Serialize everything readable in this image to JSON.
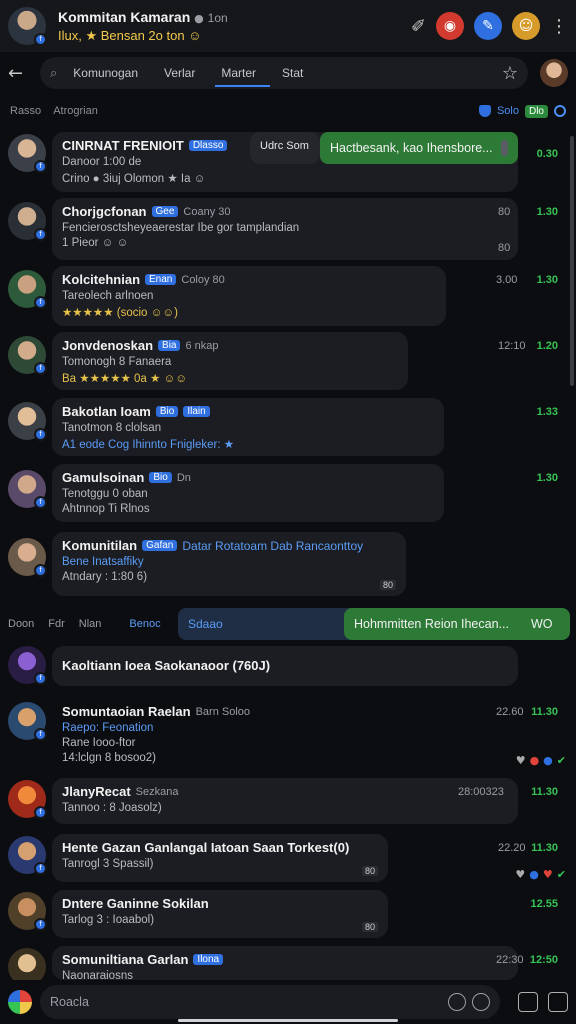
{
  "header": {
    "title": "Kommitan Kamaran",
    "title_suffix": "1on",
    "subtitle": "Ilux, ★ Bensan 2o ton ☺"
  },
  "tabs": {
    "items": [
      "Komunogan",
      "Verlar",
      "Marter",
      "Stat"
    ],
    "active": "Marter"
  },
  "section": {
    "left": "Rasso",
    "left2": "Atrogrian",
    "right_blue": "Solo",
    "right_green": "Dlo"
  },
  "chats": [
    {
      "name": "CINRNAT FRENIOIT",
      "tag": "Dlasso",
      "line1": "Danoor 1:00 de",
      "line2": "Crino ● 3iuj Olomon ★ Ia ☺",
      "pill_left": "Udrc Som",
      "pill_text": "Hactbesank, kao Ihensbore...",
      "green_time": "0.30"
    },
    {
      "name": "Chorjgcfonan",
      "tag": "Gee",
      "muted": "Coany 30",
      "line1": "Fencierosctsheyeaerestar Ibe gor tamplandian",
      "line2": "1 Pieor ☺ ☺",
      "time": "80",
      "time2": "80",
      "green_time": "1.30"
    },
    {
      "name": "Kolcitehnian",
      "tag": "Enan",
      "muted": "Coloy 80",
      "line1": "Tareolech arlnoen",
      "line2": "★★★★★ (socio ☺☺)",
      "time": "3.00",
      "green_time": "1.30"
    },
    {
      "name": "Jonvdenoskan",
      "tag": "Bia",
      "muted": "6 nkap",
      "line1": "Tomonogh 8 Fanaera",
      "line2": "Ba ★★★★★ 0a ★ ☺☺",
      "time": "12:10",
      "green_time": "1.20"
    },
    {
      "name": "Bakotlan Ioam",
      "tag": "Bio",
      "tag2": "Ilain",
      "line1": "Tanotmon 8 clolsan",
      "line2": "A1 eode Cog Ihinnto Fnigleker: ★",
      "green_time": "1.33"
    },
    {
      "name": "Gamulsoinan",
      "tag": "Bio",
      "muted": "Dn",
      "line1": "Tenotggu 0 oban",
      "line2": "Ahtnnop Ti Rlnos",
      "green_time": "1.30"
    },
    {
      "name": "Komunitilan",
      "name2": "Gafan",
      "name3": "Datar Rotatoam Dab Rancaonttoy",
      "line1": "Bene Inatsaffiky",
      "line2": "Atndary : 1:80 6)",
      "mini": "80"
    }
  ],
  "divider": {
    "items": [
      "Doon",
      "Fdr",
      "Nlan"
    ],
    "active": "Benoc",
    "highlight": "Sdaao",
    "pill_text": "Hohmmitten Reion Ihecan...",
    "pill_code": "WO"
  },
  "chats2": [
    {
      "name": "Kaoltiann Ioea Saokanaoor (760J)"
    },
    {
      "name": "Somuntaoian Raelan",
      "muted": "Barn Soloo",
      "line1": "Raepo: Feonation",
      "line2": "Rane Iooo-ftor",
      "line3": "14:lclgn 8 bosoo2)",
      "time": "22.60",
      "green_time": "11.30"
    },
    {
      "name": "JlanyRecat",
      "muted": "Sezkana",
      "line1": "Tannoo : 8 Joasolz)",
      "time": "28:00323",
      "green_time": "11.30"
    },
    {
      "name": "Hente Gazan Ganlangal Iatoan Saan Torkest(0)",
      "line1": "Tanrogl 3 Spassil)",
      "time": "22.20",
      "green_time": "11.30",
      "mini": "80"
    },
    {
      "name": "Dntere Ganinne Sokilan",
      "line1": "Tarlog 3 : Ioaabol)",
      "green_time": "12.55",
      "mini": "80"
    },
    {
      "name": "Somuniltiana Garlan",
      "tag": "Ilona",
      "line1": "Naonaraiosns",
      "time": "22:30",
      "green_time": "12:50"
    }
  ],
  "input": {
    "placeholder": "Roacla"
  }
}
